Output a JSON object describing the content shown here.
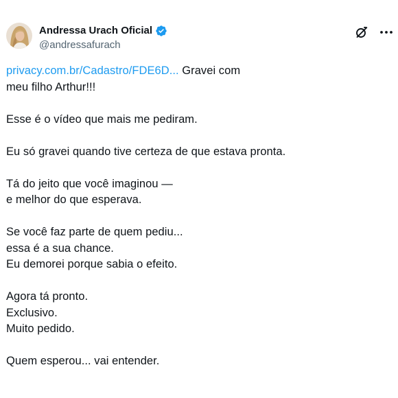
{
  "author": {
    "display_name": "Andressa Urach Oficial",
    "handle": "@andressafurach",
    "verified": true,
    "verified_color": "#1d9bf0"
  },
  "actions": {
    "grok_icon": "grok-icon",
    "more_icon": "more-options-icon"
  },
  "tweet": {
    "link_text": "privacy.com.br/Cadastro/FDE6D...",
    "line1_rest": " Gravei com",
    "line2": "meu filho Arthur!!!",
    "p2": "Esse é o vídeo que mais me pediram.",
    "p3": "Eu só gravei quando tive certeza de que estava pronta.",
    "p4_l1": "Tá do jeito que você imaginou —",
    "p4_l2": "e melhor do que esperava.",
    "p5_l1": "Se você faz parte de quem pediu...",
    "p5_l2": "essa é a sua chance.",
    "p5_l3": "Eu demorei porque sabia o efeito.",
    "p6_l1": "Agora tá pronto.",
    "p6_l2": "Exclusivo.",
    "p6_l3": "Muito pedido.",
    "p7": "Quem esperou... vai entender."
  },
  "colors": {
    "text": "#0f1419",
    "muted": "#536471",
    "link": "#1d9bf0"
  }
}
